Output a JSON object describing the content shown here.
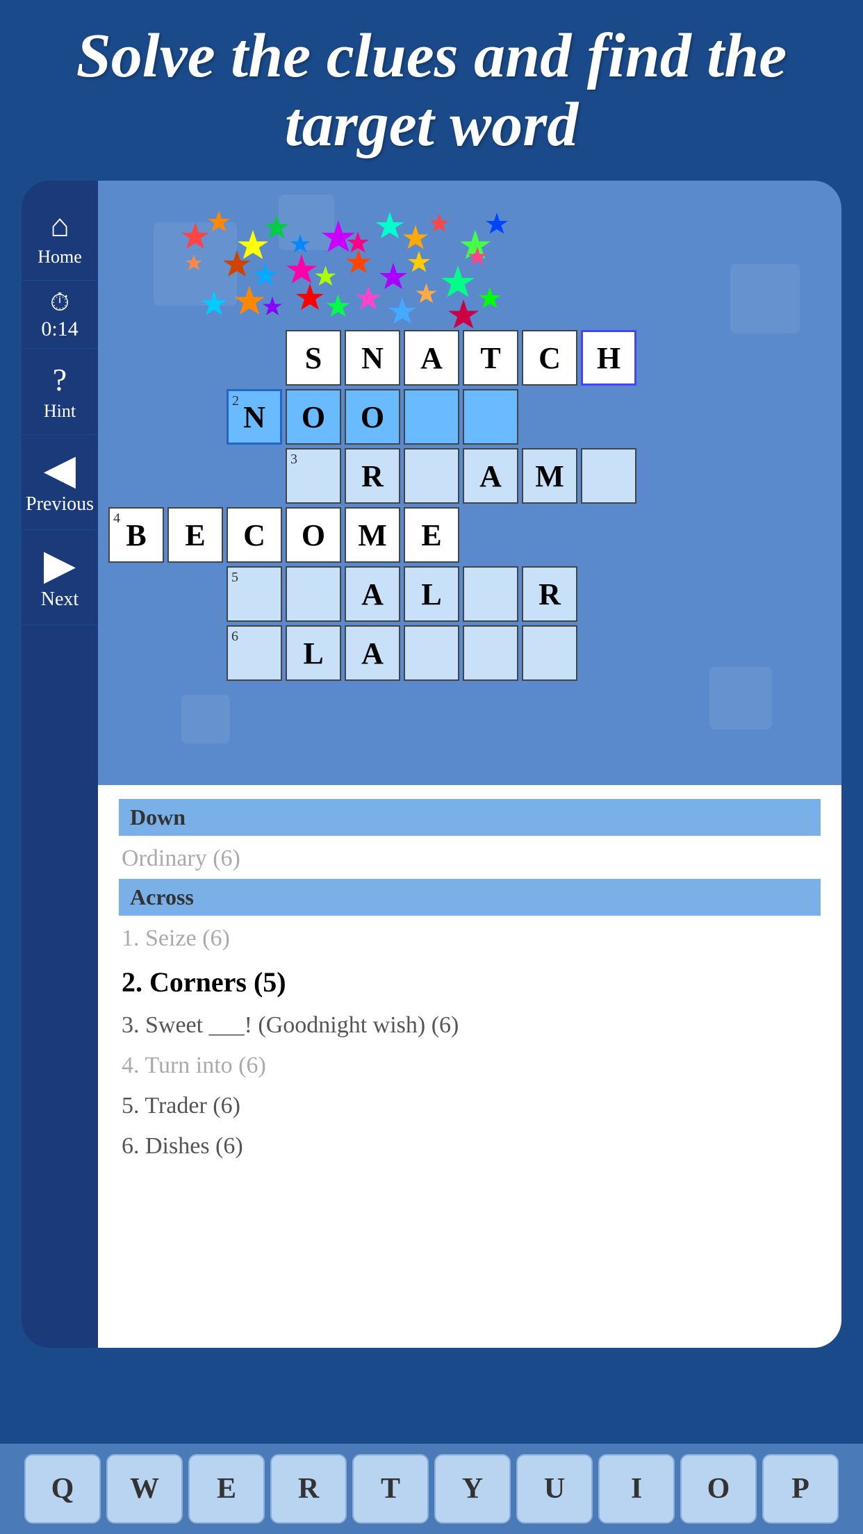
{
  "header": {
    "title": "Solve the clues and find the target word"
  },
  "sidebar": {
    "home_label": "Home",
    "timer": "0:14",
    "hint_label": "Hint",
    "previous_label": "Previous",
    "next_label": "Next"
  },
  "grid": {
    "word1": "SNATCH",
    "word2": "NOO",
    "row3_letters": {
      "R": true,
      "A": true,
      "M": true
    },
    "word4": "BECOME",
    "row5_letters": {
      "A": true,
      "L": true,
      "R": true
    },
    "row6_letters": {
      "L": true,
      "A": true
    }
  },
  "clues": {
    "down_header": "Down",
    "down_items": [
      {
        "text": "Ordinary (6)",
        "done": true
      }
    ],
    "across_header": "Across",
    "across_items": [
      {
        "num": "1",
        "text": "Seize (6)",
        "done": true
      },
      {
        "num": "2",
        "text": "Corners (5)",
        "active": true
      },
      {
        "num": "3",
        "text": "Sweet ___! (Goodnight wish) (6)",
        "done": false
      },
      {
        "num": "4",
        "text": "Turn into (6)",
        "done": true
      },
      {
        "num": "5",
        "text": "Trader (6)",
        "done": false
      },
      {
        "num": "6",
        "text": "Dishes (6)",
        "done": false
      }
    ]
  },
  "keyboard": {
    "keys": [
      "Q",
      "W",
      "E",
      "R",
      "T",
      "Y",
      "U",
      "I",
      "O",
      "P"
    ]
  },
  "colors": {
    "bg": "#1a4a8a",
    "sidebar": "#1a3a7a",
    "grid_bg": "#5a8acc",
    "cell": "#d0e8ff",
    "cell_selected": "#6abaff",
    "clue_header": "#7ab0e8"
  }
}
